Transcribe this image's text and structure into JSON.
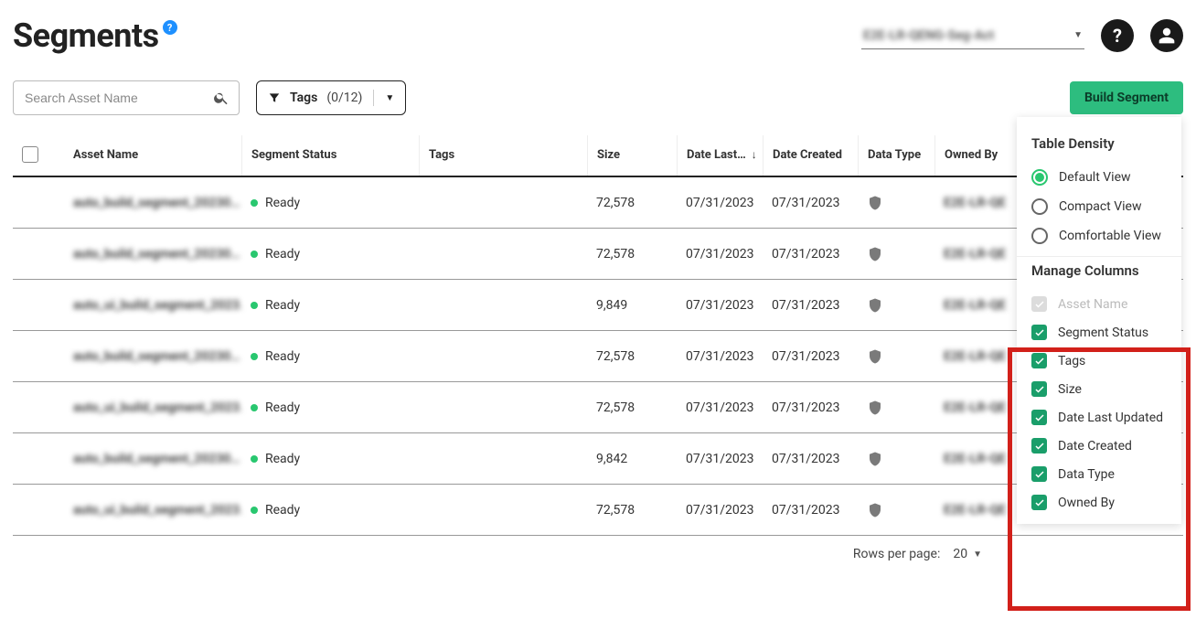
{
  "header": {
    "title": "Segments",
    "help_badge": "?",
    "account_label": "E2E-LR-QENG-Seg-Act"
  },
  "toolbar": {
    "search_placeholder": "Search Asset Name",
    "tags_label": "Tags",
    "tags_count": "(0/12)",
    "build_btn": "Build Segment"
  },
  "columns": {
    "asset_name": "Asset Name",
    "segment_status": "Segment Status",
    "tags": "Tags",
    "size": "Size",
    "date_last": "Date Last…",
    "date_created": "Date Created",
    "data_type": "Data Type",
    "owned_by": "Owned By"
  },
  "rows": [
    {
      "name": "auto_build_segment_20230…",
      "status": "Ready",
      "size": "72,578",
      "updated": "07/31/2023",
      "created": "07/31/2023",
      "owned_by": "E2E-LR-QEN…"
    },
    {
      "name": "auto_build_segment_20230…",
      "status": "Ready",
      "size": "72,578",
      "updated": "07/31/2023",
      "created": "07/31/2023",
      "owned_by": "E2E-LR-QEN…"
    },
    {
      "name": "auto_ui_build_segment_2023…",
      "status": "Ready",
      "size": "9,849",
      "updated": "07/31/2023",
      "created": "07/31/2023",
      "owned_by": "E2E-LR-QEN…"
    },
    {
      "name": "auto_build_segment_20230…",
      "status": "Ready",
      "size": "72,578",
      "updated": "07/31/2023",
      "created": "07/31/2023",
      "owned_by": "E2E-LR-QEN…"
    },
    {
      "name": "auto_ui_build_segment_2023…",
      "status": "Ready",
      "size": "72,578",
      "updated": "07/31/2023",
      "created": "07/31/2023",
      "owned_by": "E2E-LR-QEN…"
    },
    {
      "name": "auto_build_segment_20230…",
      "status": "Ready",
      "size": "9,842",
      "updated": "07/31/2023",
      "created": "07/31/2023",
      "owned_by": "E2E-LR-QEN…"
    },
    {
      "name": "auto_ui_build_segment_2023…",
      "status": "Ready",
      "size": "72,578",
      "updated": "07/31/2023",
      "created": "07/31/2023",
      "owned_by": "E2E-LR-QEN…"
    }
  ],
  "pagination": {
    "rows_label": "Rows per page:",
    "rows_value": "20"
  },
  "settings": {
    "density_title": "Table Density",
    "density_options": {
      "default": "Default View",
      "compact": "Compact View",
      "comfortable": "Comfortable View"
    },
    "manage_title": "Manage Columns",
    "columns": {
      "asset_name": "Asset Name",
      "segment_status": "Segment Status",
      "tags": "Tags",
      "size": "Size",
      "date_last_updated": "Date Last Updated",
      "date_created": "Date Created",
      "data_type": "Data Type",
      "owned_by": "Owned By"
    }
  }
}
